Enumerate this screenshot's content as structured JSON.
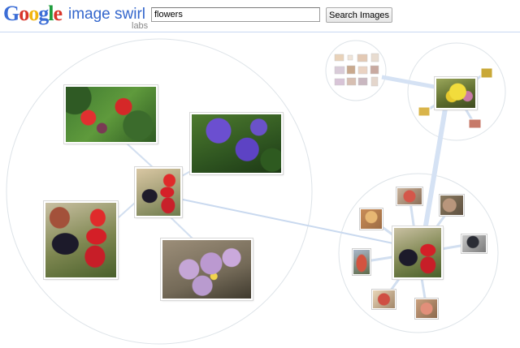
{
  "header": {
    "logo_letters": [
      "G",
      "o",
      "o",
      "g",
      "l",
      "e"
    ],
    "logo_colors": [
      "#3b6dd6",
      "#d8352a",
      "#f2b50f",
      "#3b6dd6",
      "#1c9b3a",
      "#d8352a"
    ],
    "logo_suffix": "image swirl",
    "logo_labs": "labs",
    "search_value": "flowers",
    "search_button_label": "Search Images"
  },
  "colors": {
    "accent": "#3366cc",
    "circle_stroke": "#dde3e8",
    "link_stroke": "#c6d6ee"
  },
  "clusters": [
    {
      "name": "main-cluster",
      "images": [
        {
          "name": "red-flowers-thumb",
          "icon": "red-flower-photo"
        },
        {
          "name": "purple-geranium-thumb",
          "icon": "purple-flower-photo"
        },
        {
          "name": "butterfly-cardinal-center-thumb",
          "icon": "butterfly-flower-photo"
        },
        {
          "name": "butterfly-cardinal-large-thumb",
          "icon": "butterfly-flower-photo"
        },
        {
          "name": "lavender-flowers-thumb",
          "icon": "lavender-flower-photo"
        }
      ]
    },
    {
      "name": "butterfly-cluster",
      "images": 9
    },
    {
      "name": "yellow-flower-cluster",
      "images": 5
    },
    {
      "name": "small-grid-cluster",
      "images": 16
    }
  ]
}
